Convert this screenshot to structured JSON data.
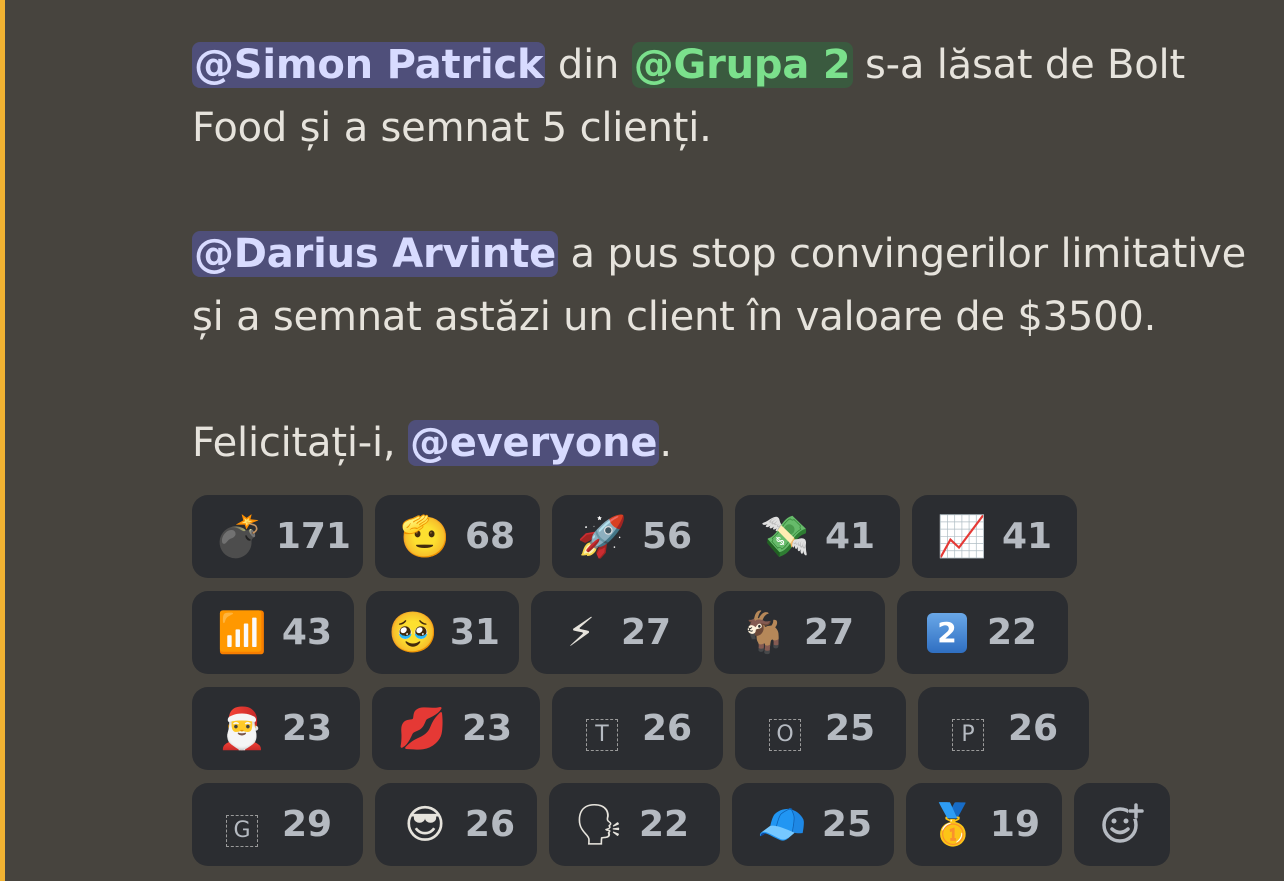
{
  "message": {
    "p1": {
      "mention_user": "@Simon Patrick",
      "text_a": " din ",
      "mention_role": "@Grupa 2",
      "text_b": " s-a lăsat de Bolt Food și a semnat 5 clienți."
    },
    "p2": {
      "mention_user": "@Darius Arvinte",
      "text": " a pus stop convingerilor limitative și a semnat astăzi un client în valoare de $3500."
    },
    "p3": {
      "text_a": "Felicitați-i, ",
      "mention": "@everyone",
      "text_b": "."
    }
  },
  "reactions": {
    "row1": [
      {
        "emoji": "💣",
        "count": "171",
        "icon": "bomb-icon"
      },
      {
        "emoji": "🫡",
        "count": "68",
        "icon": "saluting-face-icon"
      },
      {
        "emoji": "🚀",
        "count": "56",
        "icon": "rocket-icon"
      },
      {
        "emoji": "💸",
        "count": "41",
        "icon": "money-with-wings-icon"
      },
      {
        "emoji": "📈",
        "count": "41",
        "icon": "chart-increasing-icon"
      }
    ],
    "row2": [
      {
        "emoji": "📶",
        "count": "43",
        "icon": "signal-money-icon"
      },
      {
        "emoji": "🥹",
        "count": "31",
        "icon": "holding-back-tears-icon"
      },
      {
        "emoji": "⚡",
        "count": "27",
        "icon": "lightning-icon"
      },
      {
        "emoji": "🐐",
        "count": "27",
        "icon": "goat-icon"
      },
      {
        "emoji": "2",
        "count": "22",
        "icon": "keycap-two-icon"
      }
    ],
    "row3": [
      {
        "emoji": "🎅",
        "count": "23",
        "icon": "santa-icon"
      },
      {
        "emoji": "💋",
        "count": "23",
        "icon": "kiss-mark-icon"
      },
      {
        "emoji": "T",
        "count": "26",
        "icon": "letter-t-icon"
      },
      {
        "emoji": "O",
        "count": "25",
        "icon": "letter-o-icon"
      },
      {
        "emoji": "P",
        "count": "26",
        "icon": "letter-p-icon"
      }
    ],
    "row4": [
      {
        "emoji": "G",
        "count": "29",
        "icon": "letter-g-icon"
      },
      {
        "emoji": "😎",
        "count": "26",
        "icon": "custom-avatar-sunglasses-icon"
      },
      {
        "emoji": "🗣",
        "count": "22",
        "icon": "speaking-head-icon"
      },
      {
        "emoji": "🧢",
        "count": "25",
        "icon": "custom-avatar-cap-icon"
      },
      {
        "emoji": "🥇",
        "count": "19",
        "icon": "first-place-medal-icon"
      }
    ],
    "add_icon": "add-reaction-icon"
  }
}
